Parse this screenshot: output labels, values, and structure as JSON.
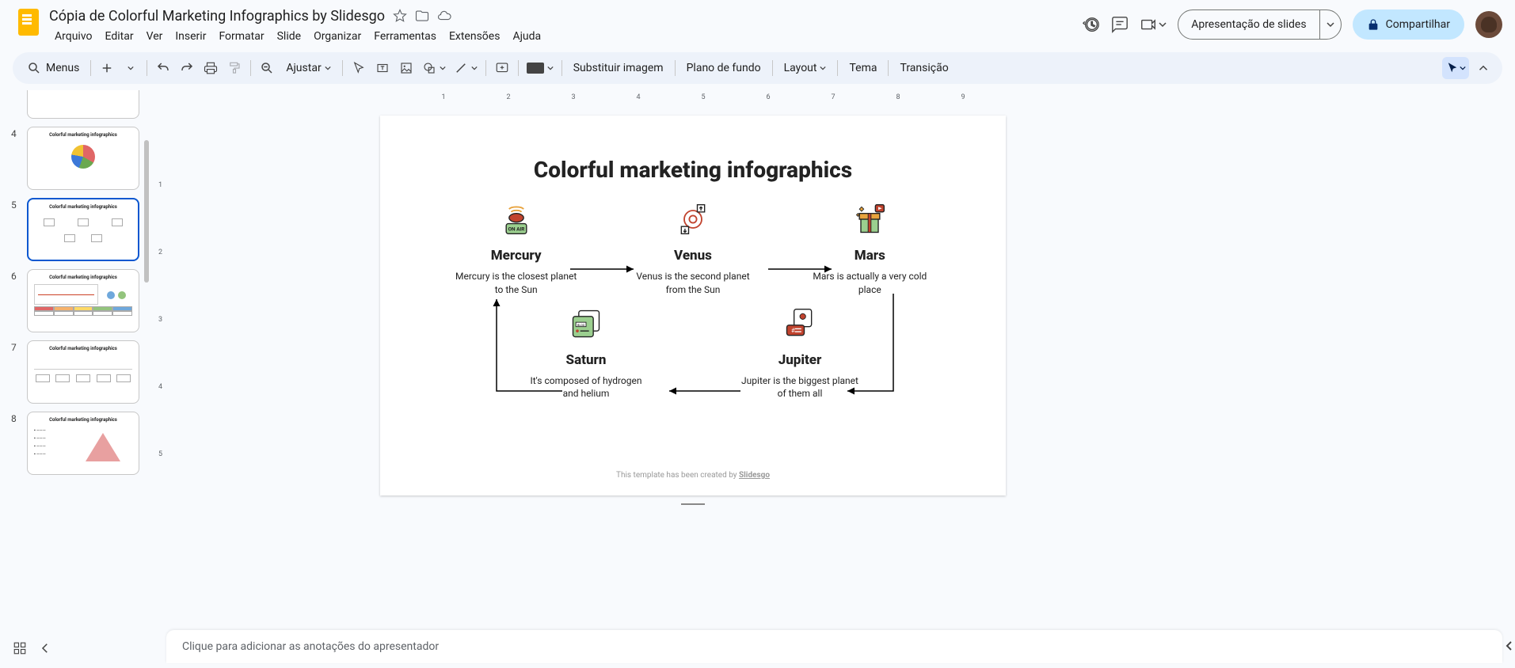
{
  "header": {
    "doc_title": "Cópia de Colorful Marketing Infographics by Slidesgo",
    "menubar": [
      "Arquivo",
      "Editar",
      "Ver",
      "Inserir",
      "Formatar",
      "Slide",
      "Organizar",
      "Ferramentas",
      "Extensões",
      "Ajuda"
    ],
    "slideshow_btn": "Apresentação de slides",
    "share_btn": "Compartilhar"
  },
  "toolbar": {
    "search_label": "Menus",
    "fit_label": "Ajustar",
    "replace_image": "Substituir imagem",
    "background": "Plano de fundo",
    "layout": "Layout",
    "theme": "Tema",
    "transition": "Transição"
  },
  "filmstrip": {
    "thumb_title": "Colorful marketing infographics",
    "numbers": [
      "4",
      "5",
      "6",
      "7",
      "8"
    ]
  },
  "ruler_h": [
    "1",
    "2",
    "3",
    "4",
    "5",
    "6",
    "7",
    "8",
    "9"
  ],
  "ruler_v": [
    "1",
    "2",
    "3",
    "4",
    "5"
  ],
  "slide": {
    "title": "Colorful marketing infographics",
    "items_top": [
      {
        "name": "Mercury",
        "desc": "Mercury is the closest planet to the Sun"
      },
      {
        "name": "Venus",
        "desc": "Venus is the second planet from the Sun"
      },
      {
        "name": "Mars",
        "desc": "Mars is actually a very cold place"
      }
    ],
    "items_bottom": [
      {
        "name": "Saturn",
        "desc": "It's composed of hydrogen and helium"
      },
      {
        "name": "Jupiter",
        "desc": "Jupiter is the biggest planet of them all"
      }
    ],
    "footer_pre": "This template has been created by ",
    "footer_link": "Slidesgo"
  },
  "notes": {
    "placeholder": "Clique para adicionar as anotações do apresentador"
  }
}
